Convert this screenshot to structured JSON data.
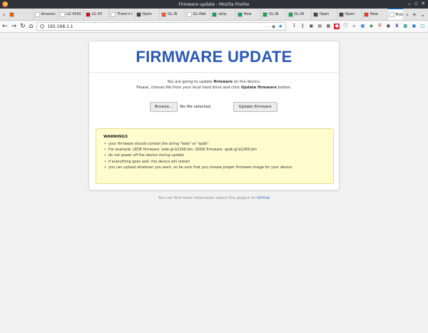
{
  "window": {
    "title": "Firmware update - Mozilla Firefox"
  },
  "tabs": [
    {
      "label": "",
      "icon": "firefox-icon",
      "color": "#e66000"
    },
    {
      "label": "Amazon",
      "icon": "amazon-icon",
      "color": "#ffffff"
    },
    {
      "label": "LG 43UC",
      "icon": "lg-icon",
      "color": "#ffffff"
    },
    {
      "label": "LG 43",
      "icon": "lg-red-icon",
      "color": "#c8102e"
    },
    {
      "label": "There's t",
      "icon": "page-icon",
      "color": "#ffffff"
    },
    {
      "label": "Open",
      "icon": "openwrt-icon",
      "color": "#444444"
    },
    {
      "label": "GL.iN",
      "icon": "glinet-icon",
      "color": "#f05a28"
    },
    {
      "label": "GL-iNet",
      "icon": "page-icon",
      "color": "#ffffff"
    },
    {
      "label": "ubiq",
      "icon": "ubiquiti-icon",
      "color": "#18a05e"
    },
    {
      "label": "How",
      "icon": "page-icon",
      "color": "#18a05e"
    },
    {
      "label": "GL.iN",
      "icon": "glinet-icon",
      "color": "#18a05e"
    },
    {
      "label": "GL-iN",
      "icon": "glinet-icon",
      "color": "#18a05e"
    },
    {
      "label": "Open",
      "icon": "openwrt-icon",
      "color": "#444444"
    },
    {
      "label": "Open",
      "icon": "openwrt-icon",
      "color": "#444444"
    },
    {
      "label": "New",
      "icon": "chrome-icon",
      "color": "#e33b2e"
    },
    {
      "label": "Firmw",
      "icon": "page-icon",
      "color": "#ffffff",
      "active": true
    }
  ],
  "nav": {
    "url": "192.168.1.1"
  },
  "page": {
    "heading": "FIRMWARE UPDATE",
    "intro_line1_pre": "You are going to update ",
    "intro_line1_bold": "firmware",
    "intro_line1_post": " on the device.",
    "intro_line2_pre": "Please, choose file from your local hard drive and click ",
    "intro_line2_bold": "Update firmware",
    "intro_line2_post": " button.",
    "browse_label": "Browse...",
    "no_file_text": "No file selected.",
    "update_label": "Update firmware",
    "warnings_title": "WARNINGS",
    "warnings": [
      "your firmware should contain the string \"lede\" or \"qsdk\".",
      "For example: LEDE firmware: lede-gl-b1300.bin, QSDK firmware: qsdk-gl-b1300.bin",
      "do not power off the device during update",
      "if everything goes well, the device will restart",
      "you can upload whatever you want, so be sure that you choose proper firmware image for your device"
    ],
    "footer_pre": "You can find more information about this project on ",
    "footer_link": "GitHub"
  },
  "colors": {
    "heading": "#2b58b4",
    "warning_bg": "#fffdd0",
    "link": "#3a6fc1"
  }
}
